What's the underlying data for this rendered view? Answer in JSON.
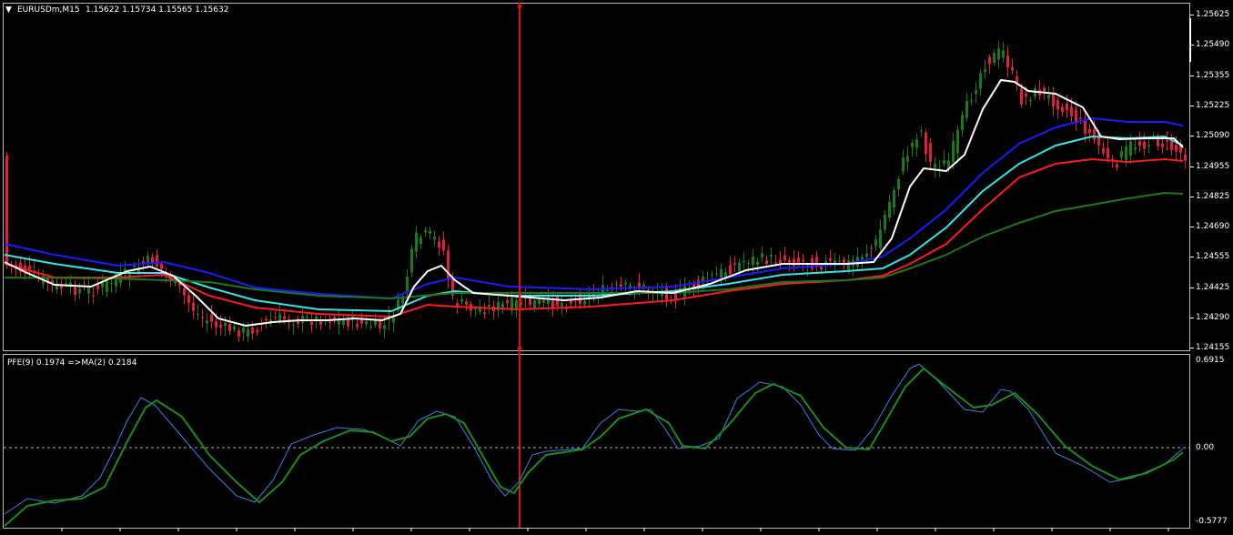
{
  "window": {
    "title": "EURUSDm,M15",
    "ohlc": "1.15622 1.15734 1.15565 1.15632"
  },
  "price_axis": [
    "1.25625",
    "1.25490",
    "1.25355",
    "1.25225",
    "1.25090",
    "1.24955",
    "1.24825",
    "1.24690",
    "1.24555",
    "1.24425",
    "1.24290",
    "1.24155"
  ],
  "indicator": {
    "label": "PFE(9) 0.1974 =>MA(2) 0.2184",
    "axis": [
      "0.6915",
      "0.00",
      "-0.5777"
    ]
  },
  "colors": {
    "bull": "#1a7a1a",
    "bear": "#e0203a",
    "ma_white": "#ffffff",
    "ma_blue": "#1a1aff",
    "ma_cyan": "#33e5e5",
    "ma_red": "#ff1a1a",
    "ma_green": "#1a7a1a",
    "pfe": "#3a7fe6",
    "pfe_ma": "#1a8c1a",
    "vline": "#e01010"
  },
  "chart_data": {
    "type": "line",
    "price_range": [
      1.24155,
      1.25625
    ],
    "indicator_range": [
      -0.5777,
      0.6915
    ]
  }
}
